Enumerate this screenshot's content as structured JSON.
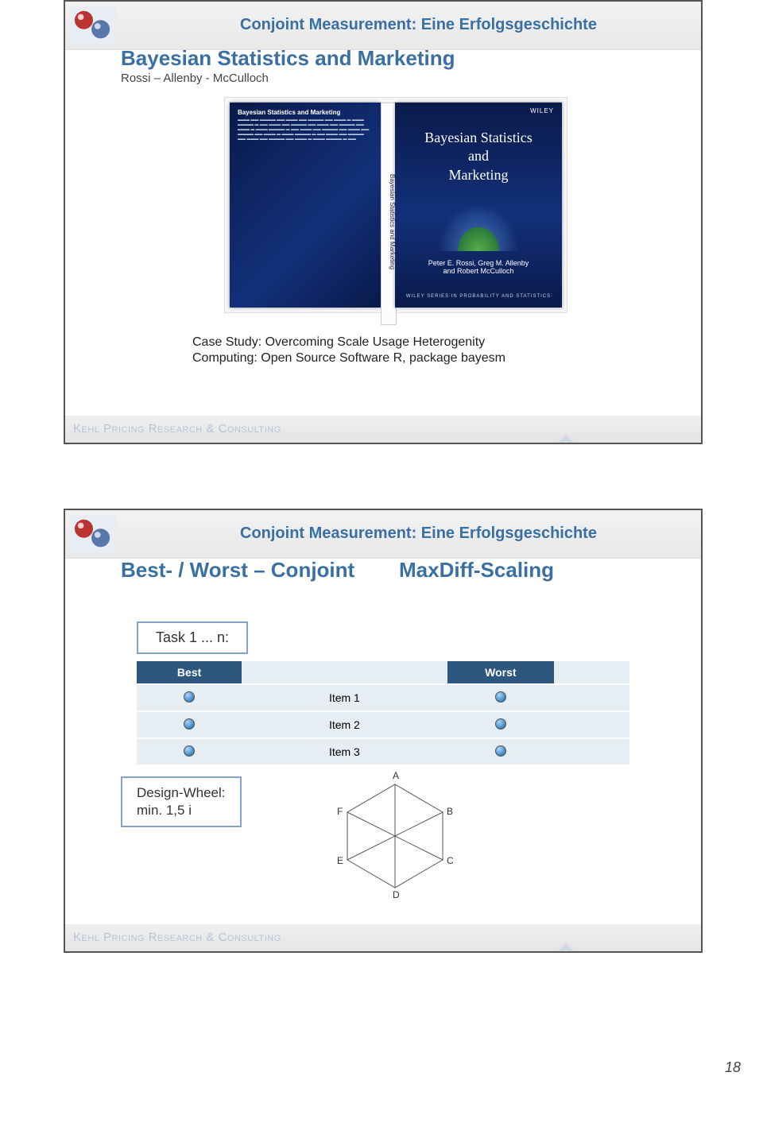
{
  "super_title": "Conjoint Measurement: Eine Erfolgsgeschichte",
  "footer": "Kehl Pricing Research & Consulting",
  "page_number": "18",
  "slide1": {
    "title": "Bayesian Statistics and Marketing",
    "subtitle": "Rossi – Allenby - McCulloch",
    "book": {
      "publisher": "WILEY",
      "spine": "Bayesian Statistics and Marketing",
      "front_title_l1": "Bayesian Statistics",
      "front_title_l2": "and",
      "front_title_l3": "Marketing",
      "authors": "Peter E. Rossi, Greg M. Allenby",
      "authors2": "and Robert McCulloch",
      "series": "WILEY SERIES IN PROBABILITY AND STATISTICS",
      "back_title": "Bayesian Statistics and Marketing"
    },
    "case_study": "Case Study: Overcoming Scale Usage Heterogenity",
    "computing": "Computing: Open Source Software R, package bayesm"
  },
  "slide2": {
    "title_left": "Best- / Worst – Conjoint",
    "title_right": "MaxDiff-Scaling",
    "task_label": "Task 1 ... n:",
    "col_best": "Best",
    "col_worst": "Worst",
    "items": [
      "Item 1",
      "Item 2",
      "Item 3"
    ],
    "wheel_l1": "Design-Wheel:",
    "wheel_l2": "min. 1,5 i",
    "hex_labels": [
      "A",
      "B",
      "C",
      "D",
      "E",
      "F"
    ]
  }
}
